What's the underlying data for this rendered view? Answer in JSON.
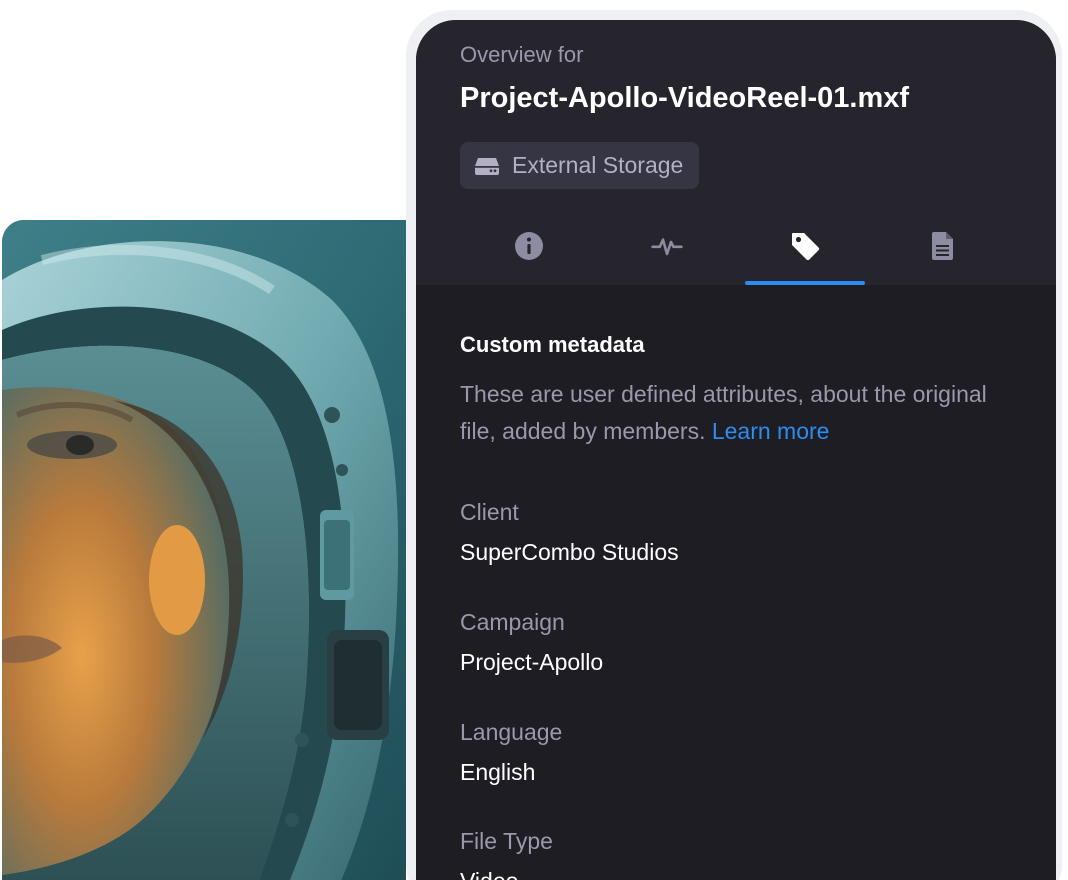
{
  "overview": {
    "eyebrow": "Overview for",
    "file_name": "Project-Apollo-VideoReel-01.mxf",
    "storage_label": "External Storage",
    "storage_icon": "hard-drive-icon"
  },
  "tabs": [
    {
      "icon": "info-icon",
      "active": false
    },
    {
      "icon": "waveform-icon",
      "active": false
    },
    {
      "icon": "tag-icon",
      "active": true
    },
    {
      "icon": "document-icon",
      "active": false
    }
  ],
  "metadata": {
    "title": "Custom metadata",
    "description": "These are user defined attributes, about the original file, added by members.",
    "learn_more": "Learn more",
    "fields": [
      {
        "label": "Client",
        "value": "SuperCombo Studios"
      },
      {
        "label": "Campaign",
        "value": "Project-Apollo"
      },
      {
        "label": "Language",
        "value": "English"
      },
      {
        "label": "File Type",
        "value": "Video"
      }
    ]
  },
  "colors": {
    "panel_bg": "#1e1d24",
    "header_bg": "#26252e",
    "accent": "#2d8cf0",
    "muted_text": "#9a98ab",
    "badge_bg": "#363543"
  }
}
